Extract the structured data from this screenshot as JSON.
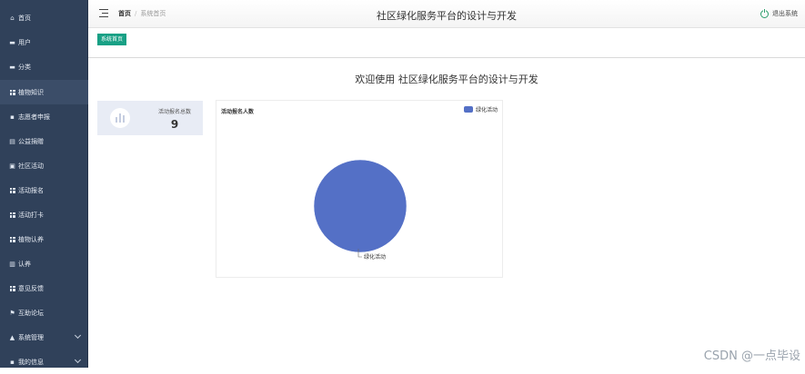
{
  "sidebar": {
    "items": [
      {
        "label": "首页",
        "icon": "home-icon"
      },
      {
        "label": "用户",
        "icon": "user-icon"
      },
      {
        "label": "分类",
        "icon": "category-icon"
      },
      {
        "label": "植物知识",
        "icon": "grid-icon"
      },
      {
        "label": "志愿者申报",
        "icon": "person-icon"
      },
      {
        "label": "公益捐赠",
        "icon": "donate-icon"
      },
      {
        "label": "社区活动",
        "icon": "briefcase-icon"
      },
      {
        "label": "活动报名",
        "icon": "grid-icon"
      },
      {
        "label": "活动打卡",
        "icon": "grid-icon"
      },
      {
        "label": "植物认养",
        "icon": "grid-icon"
      },
      {
        "label": "认养",
        "icon": "bar-chart-icon"
      },
      {
        "label": "意见反馈",
        "icon": "grid-icon"
      },
      {
        "label": "互助论坛",
        "icon": "flag-icon"
      },
      {
        "label": "系统管理",
        "icon": "car-icon"
      },
      {
        "label": "我的信息",
        "icon": "person-icon"
      }
    ]
  },
  "topbar": {
    "breadcrumb_home": "首页",
    "breadcrumb_sep": "/",
    "breadcrumb_current": "系统首页",
    "title": "社区绿化服务平台的设计与开发",
    "logout_label": "退出系统"
  },
  "tabs": {
    "active_label": "系统首页"
  },
  "welcome": "欢迎使用 社区绿化服务平台的设计与开发",
  "stat": {
    "label": "活动报名总数",
    "value": "9"
  },
  "chart_data": {
    "type": "pie",
    "title": "活动报名人数",
    "legend_position": "top-right",
    "slices": [
      {
        "name": "绿化活动",
        "value": 9,
        "color": "#5470c6"
      }
    ]
  },
  "watermark": "CSDN @一点毕设"
}
